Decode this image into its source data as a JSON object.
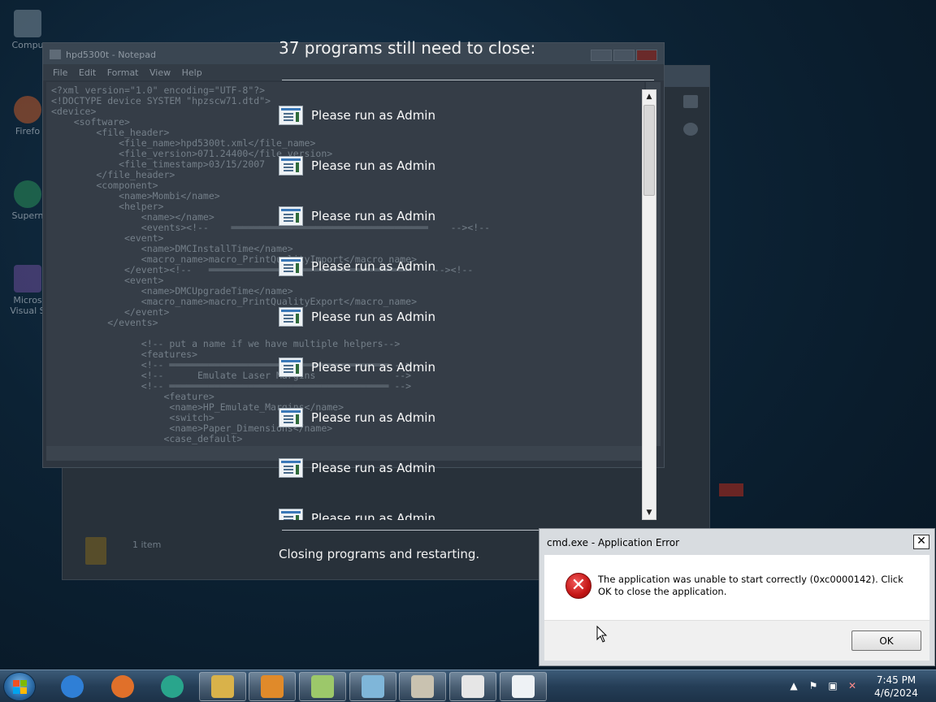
{
  "desktop": {
    "icons": [
      {
        "label": "Compu",
        "color": "#7a8c99"
      },
      {
        "label": "Firefo",
        "color": "#c25a2a"
      },
      {
        "label": "Supern",
        "color": "#2a8f5a"
      },
      {
        "label": "Micros Visual S",
        "color": "#6b4e9a"
      }
    ]
  },
  "notepad": {
    "title": "hpd5300t - Notepad",
    "menu": [
      "File",
      "Edit",
      "Format",
      "View",
      "Help"
    ],
    "lines": [
      "<?xml version=\"1.0\" encoding=\"UTF-8\"?>",
      "<!DOCTYPE device SYSTEM \"hpzscw71.dtd\">",
      "<device>",
      "    <software>",
      "        <file_header>",
      "            <file_name>hpd5300t.xml</file_name>",
      "            <file_version>071.24400</file_version>",
      "            <file_timestamp>03/15/2007",
      "        </file_header>",
      "        <component>",
      "            <name>Mombi</name>",
      "            <helper>",
      "                <name></name>",
      "                <events><!--    ═══════════════════════════════════    --><!--",
      "             <event>",
      "                <name>DMCInstallTime</name>",
      "                <macro_name>macro_PrintQualityImport</macro_name>",
      "             </event><!--   ════════════════════════════════════    --><!--",
      "             <event>",
      "                <name>DMCUpgradeTime</name>",
      "                <macro_name>macro_PrintQualityExport</macro_name>",
      "             </event>",
      "          </events>",
      "",
      "                <!-- put a name if we have multiple helpers-->",
      "                <features>",
      "                <!-- ═══════════════════════════════════════ -->",
      "                <!--      Emulate Laser Margins              -->",
      "                <!-- ═══════════════════════════════════════ -->",
      "                    <feature>",
      "                     <name>HP_Emulate_Margins</name>",
      "                     <switch>",
      "                     <name>Paper_Dimensions</name>",
      "                    <case_default>"
    ]
  },
  "explorer": {
    "item_count": "1 item"
  },
  "shutdown": {
    "heading": "37 programs still need to close:",
    "programs": [
      "Please run as Admin",
      "Please run as Admin",
      "Please run as Admin",
      "Please run as Admin",
      "Please run as Admin",
      "Please run as Admin",
      "Please run as Admin",
      "Please run as Admin",
      "Please run as Admin"
    ],
    "status": "Closing programs and restarting."
  },
  "dialog": {
    "title": "cmd.exe - Application Error",
    "message": "The application was unable to start correctly (0xc0000142). Click OK to close the application.",
    "ok_label": "OK",
    "close_glyph": "✕"
  },
  "taskbar": {
    "apps": [
      {
        "name": "internet-explorer",
        "color": "#2f7fd6",
        "open": false
      },
      {
        "name": "firefox",
        "color": "#e0702a",
        "open": false
      },
      {
        "name": "supernova",
        "color": "#29a58c",
        "open": false
      },
      {
        "name": "file-explorer",
        "color": "#d9b24a",
        "open": true
      },
      {
        "name": "media-player",
        "color": "#e08a2a",
        "open": true
      },
      {
        "name": "notepad-plus",
        "color": "#9cc86a",
        "open": true
      },
      {
        "name": "notepad",
        "color": "#7fb6d9",
        "open": true
      },
      {
        "name": "paint",
        "color": "#c9c2b0",
        "open": true
      },
      {
        "name": "xml-viewer",
        "color": "#e6e6e6",
        "open": true
      },
      {
        "name": "run-as-admin-app",
        "color": "#eef2f5",
        "open": true
      }
    ],
    "time": "7:45 PM",
    "date": "4/6/2024"
  }
}
